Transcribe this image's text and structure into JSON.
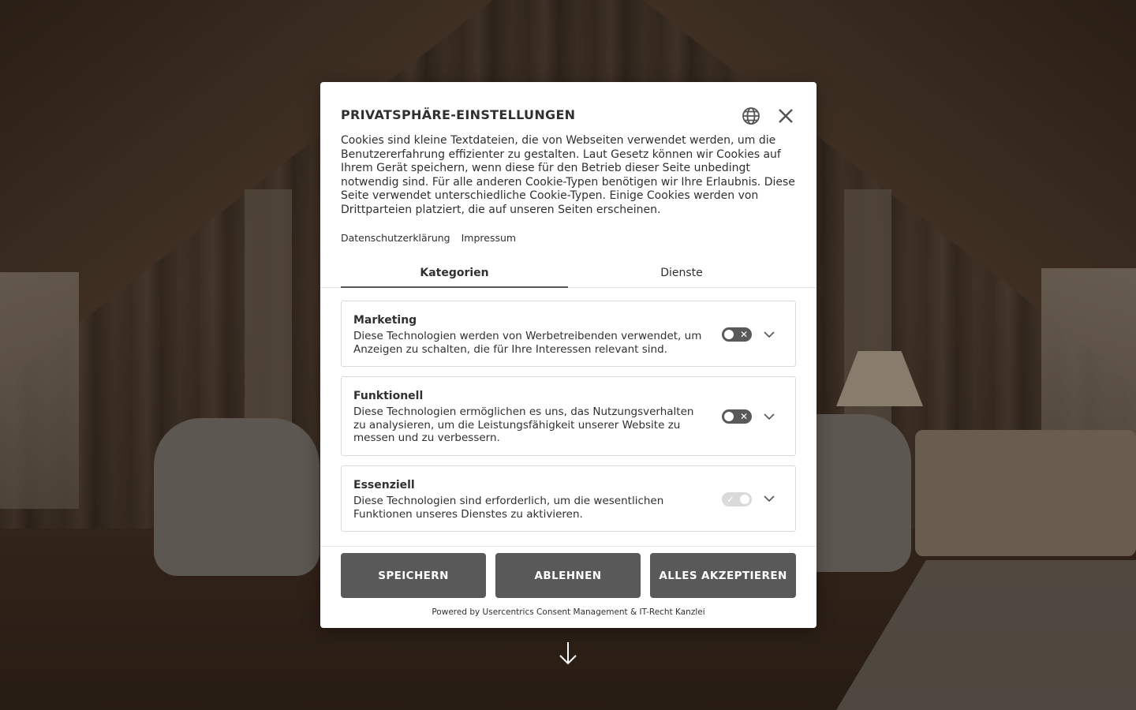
{
  "modal": {
    "title": "PRIVATSPHÄRE-EINSTELLUNGEN",
    "description": "Cookies sind kleine Textdateien, die von Webseiten verwendet werden, um die Benutzererfahrung effizienter zu gestalten. Laut Gesetz können wir Cookies auf Ihrem Gerät speichern, wenn diese für den Betrieb dieser Seite unbedingt notwendig sind. Für alle anderen Cookie-Typen benötigen wir Ihre Erlaubnis. Diese Seite verwendet unterschiedliche Cookie-Typen. Einige Cookies werden von Drittparteien platziert, die auf unseren Seiten erscheinen.",
    "links": {
      "privacy": "Datenschutzerklärung",
      "imprint": "Impressum"
    },
    "tabs": {
      "categories": "Kategorien",
      "services": "Dienste",
      "active": "categories"
    },
    "categories": [
      {
        "title": "Marketing",
        "text": "Diese Technologien werden von Werbetreibenden verwendet, um Anzeigen zu schalten, die für Ihre Interessen relevant sind.",
        "enabled": false,
        "locked": false
      },
      {
        "title": "Funktionell",
        "text": "Diese Technologien ermöglichen es uns, das Nutzungsverhalten zu analysieren, um die Leistungsfähigkeit unserer Website zu messen und zu verbessern.",
        "enabled": false,
        "locked": false
      },
      {
        "title": "Essenziell",
        "text": "Diese Technologien sind erforderlich, um die wesentlichen Funktionen unseres Dienstes zu aktivieren.",
        "enabled": true,
        "locked": true
      }
    ],
    "buttons": {
      "save": "SPEICHERN",
      "deny": "ABLEHNEN",
      "accept_all": "ALLES AKZEPTIEREN"
    },
    "powered_by": "Powered by Usercentrics Consent Management & IT-Recht Kanzlei"
  },
  "icons": {
    "language": "globe-icon",
    "close": "close-icon",
    "expand": "chevron-down-icon",
    "scroll": "arrow-down-icon"
  },
  "colors": {
    "button_bg": "#595959",
    "text": "#303030",
    "toggle_off": "#595959",
    "toggle_locked": "#dadada"
  }
}
